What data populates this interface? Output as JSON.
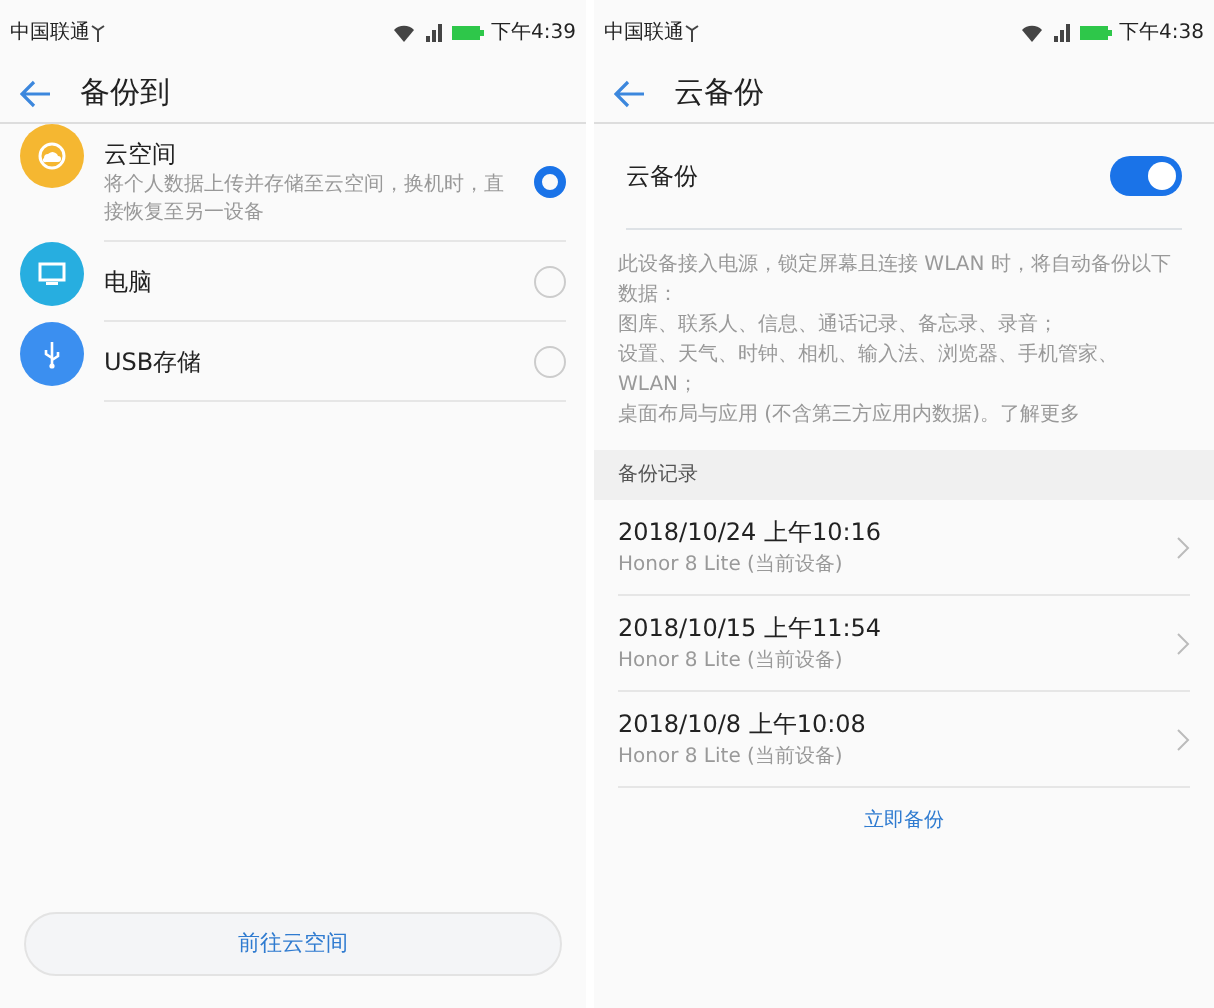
{
  "screens": [
    {
      "status_bar": {
        "carrier": "中国联通",
        "time": "下午4:39"
      },
      "title": "备份到",
      "options": [
        {
          "kind": "cloud",
          "color": "#f5b731",
          "label": "云空间",
          "description": "将个人数据上传并存储至云空间，换机时，直接恢复至另一设备",
          "selected": true
        },
        {
          "kind": "monitor",
          "color": "#27aee0",
          "label": "电脑",
          "selected": false
        },
        {
          "kind": "usb",
          "color": "#3b8ff0",
          "label": "USB存储",
          "selected": false
        }
      ],
      "button": "前往云空间"
    },
    {
      "status_bar": {
        "carrier": "中国联通",
        "time": "下午4:38"
      },
      "title": "云备份",
      "toggle": {
        "label": "云备份",
        "on": true
      },
      "description_lines": [
        "此设备接入电源，锁定屏幕且连接 WLAN 时，将自动备份以下数据：",
        "图库、联系人、信息、通话记录、备忘录、录音；",
        "设置、天气、时钟、相机、输入法、浏览器、手机管家、WLAN；",
        "桌面布局与应用 (不含第三方应用内数据)。"
      ],
      "learn_more": "了解更多",
      "section": "备份记录",
      "records": [
        {
          "date": "2018/10/24 上午10:16",
          "device": "Honor 8 Lite (当前设备)"
        },
        {
          "date": "2018/10/15 上午11:54",
          "device": "Honor 8 Lite (当前设备)"
        },
        {
          "date": "2018/10/8 上午10:08",
          "device": "Honor 8 Lite (当前设备)"
        }
      ],
      "action": "立即备份"
    }
  ]
}
